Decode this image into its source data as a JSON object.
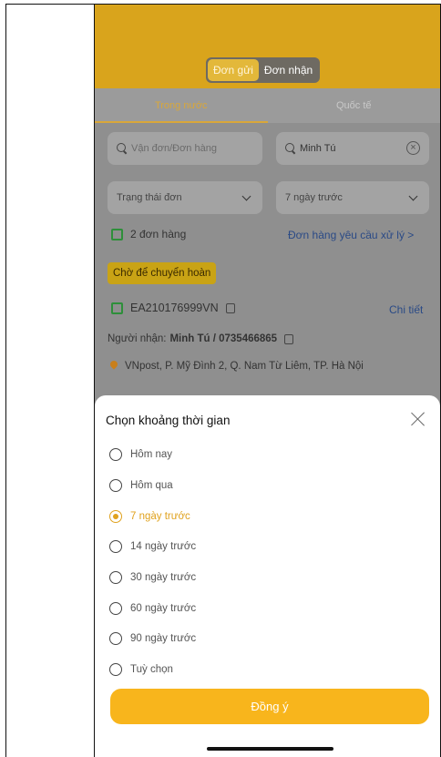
{
  "header": {
    "segments": [
      "Đơn gửi",
      "Đơn nhận"
    ],
    "active_segment": 0
  },
  "tabs": {
    "items": [
      "Trong nước",
      "Quốc tế"
    ],
    "active": 0
  },
  "filters": {
    "order_search_placeholder": "Vận đơn/Đơn hàng",
    "name_search_value": "Minh Tú",
    "status_select": "Trạng thái đơn",
    "time_select": "7 ngày trước"
  },
  "summary": {
    "order_count": "2 đơn hàng",
    "request_link": "Đơn hàng yêu cầu xử lý >"
  },
  "order": {
    "status_badge": "Chờ để chuyển hoàn",
    "tracking_code": "EA210176999VN",
    "detail_link": "Chi tiết",
    "recipient_label": "Người nhận:",
    "recipient_value": "Minh Tú / 0735466865",
    "address": "VNpost, P. Mỹ Đình 2, Q. Nam Từ Liêm, TP. Hà Nội"
  },
  "sheet": {
    "title": "Chọn khoảng thời gian",
    "options": [
      "Hôm nay",
      "Hôm qua",
      "7 ngày trước",
      "14 ngày trước",
      "30 ngày trước",
      "60 ngày trước",
      "90 ngày trước",
      "Tuỳ chọn"
    ],
    "selected_index": 2,
    "confirm_label": "Đồng ý"
  },
  "colors": {
    "brand": "#d9a41c",
    "accent": "#f8b51c",
    "selected": "#e0a21e"
  }
}
